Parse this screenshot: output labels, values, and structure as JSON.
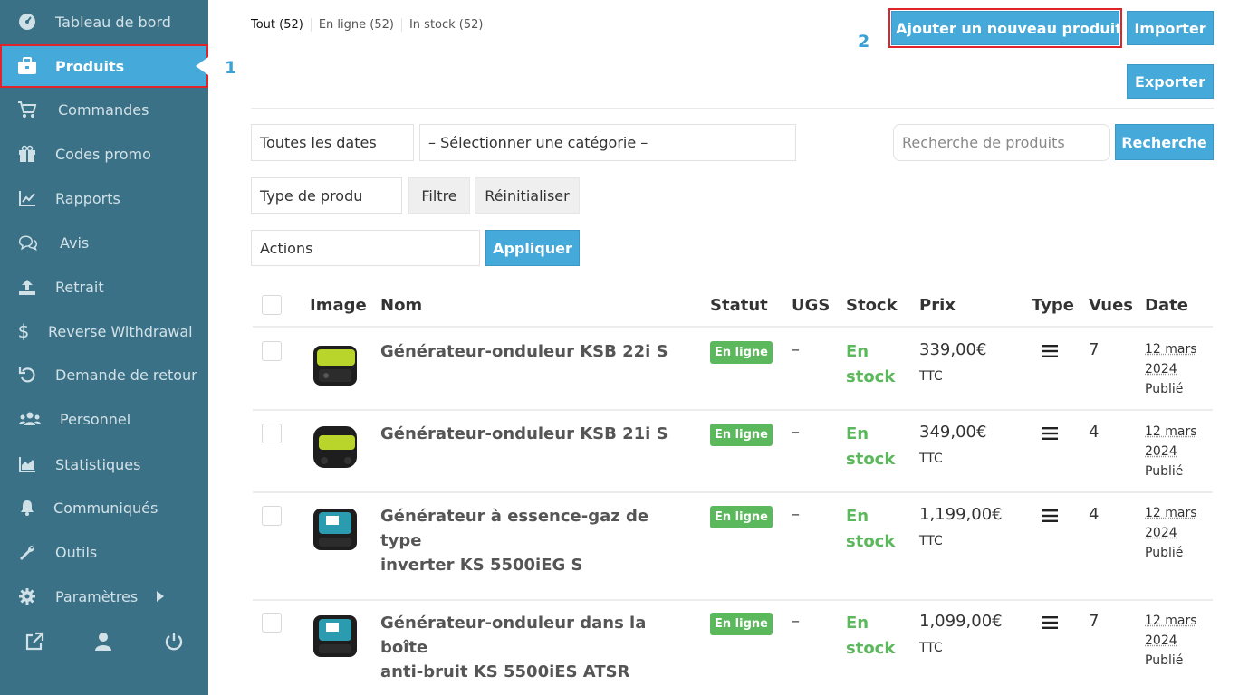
{
  "sidebar": {
    "items": [
      {
        "label": "Tableau de bord",
        "icon": "dashboard-icon"
      },
      {
        "label": "Produits",
        "icon": "briefcase-icon"
      },
      {
        "label": "Commandes",
        "icon": "cart-icon"
      },
      {
        "label": "Codes promo",
        "icon": "gift-icon"
      },
      {
        "label": "Rapports",
        "icon": "chart-line-icon"
      },
      {
        "label": "Avis",
        "icon": "comments-icon"
      },
      {
        "label": "Retrait",
        "icon": "upload-icon"
      },
      {
        "label": "Reverse Withdrawal",
        "icon": "dollar-icon"
      },
      {
        "label": "Demande de retour",
        "icon": "undo-icon"
      },
      {
        "label": "Personnel",
        "icon": "users-icon"
      },
      {
        "label": "Statistiques",
        "icon": "chart-area-icon"
      },
      {
        "label": "Communiqués",
        "icon": "bell-icon"
      },
      {
        "label": "Outils",
        "icon": "wrench-icon"
      },
      {
        "label": "Paramètres",
        "icon": "gear-icon"
      }
    ],
    "active": "Produits",
    "bottom_icons": [
      "external-link-icon",
      "user-icon",
      "power-icon"
    ]
  },
  "markers": {
    "one": "1",
    "two": "2"
  },
  "status_links": [
    "Tout (52)",
    "En ligne (52)",
    "In stock (52)"
  ],
  "buttons": {
    "add": "Ajouter un nouveau produit",
    "import": "Importer",
    "export": "Exporter",
    "search": "Recherche",
    "filter": "Filtre",
    "reset": "Réinitialiser",
    "apply": "Appliquer"
  },
  "filters": {
    "dates": "Toutes les dates",
    "category": "– Sélectionner une catégorie –",
    "search_placeholder": "Recherche de produits",
    "type": "Type de produ",
    "actions": "Actions"
  },
  "table": {
    "headers": [
      "Image",
      "Nom",
      "Statut",
      "UGS",
      "Stock",
      "Prix",
      "Type",
      "Vues",
      "Date"
    ],
    "rows": [
      {
        "name_l1": "Générateur-onduleur KSB 22i S",
        "name_l2": "",
        "status": "En ligne",
        "ugs": "–",
        "stock_l1": "En",
        "stock_l2": "stock",
        "price": "339,00€",
        "tax": "TTC",
        "views": "7",
        "date_l1": "12 mars",
        "date_l2": "2024",
        "published": "Publié",
        "color": "#b9d42a"
      },
      {
        "name_l1": "Générateur-onduleur KSB 21i S",
        "name_l2": "",
        "status": "En ligne",
        "ugs": "–",
        "stock_l1": "En",
        "stock_l2": "stock",
        "price": "349,00€",
        "tax": "TTC",
        "views": "4",
        "date_l1": "12 mars",
        "date_l2": "2024",
        "published": "Publié",
        "color": "#b9d42a"
      },
      {
        "name_l1": "Générateur à essence-gaz de type",
        "name_l2": "inverter KS 5500iEG S",
        "status": "En ligne",
        "ugs": "–",
        "stock_l1": "En",
        "stock_l2": "stock",
        "price": "1,199,00€",
        "tax": "TTC",
        "views": "4",
        "date_l1": "12 mars",
        "date_l2": "2024",
        "published": "Publié",
        "color": "#2b9bb0"
      },
      {
        "name_l1": "Générateur-onduleur dans la boîte",
        "name_l2": "anti-bruit KS 5500iES ATSR",
        "status": "En ligne",
        "ugs": "–",
        "stock_l1": "En",
        "stock_l2": "stock",
        "price": "1,099,00€",
        "tax": "TTC",
        "views": "7",
        "date_l1": "12 mars",
        "date_l2": "2024",
        "published": "Publié",
        "color": "#2b9bb0"
      }
    ]
  }
}
